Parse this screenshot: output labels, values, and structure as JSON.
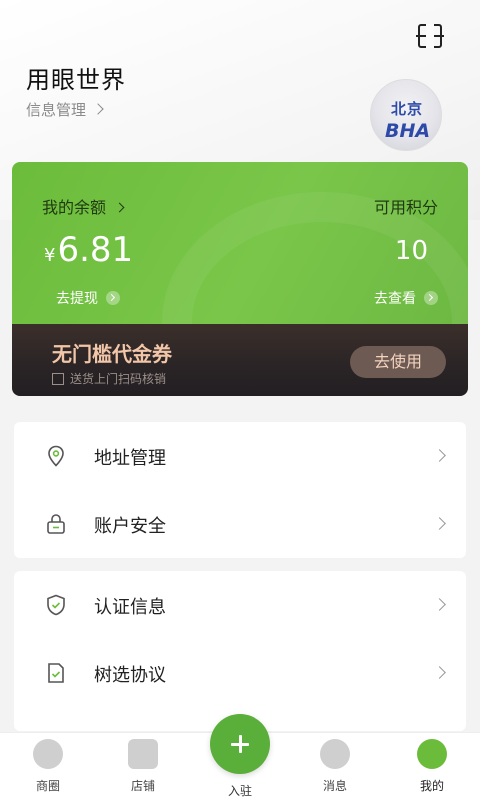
{
  "header": {
    "username": "用眼世界",
    "info_link": "信息管理",
    "avatar_text_line1": "北京",
    "avatar_text_line2": "BHA"
  },
  "wallet": {
    "balance_label": "我的余额",
    "currency_symbol": "¥",
    "balance_value": "6.81",
    "points_label": "可用积分",
    "points_value": "10",
    "withdraw_link": "去提现",
    "view_link": "去查看"
  },
  "coupon": {
    "title": "无门槛代金券",
    "subtitle": "送货上门扫码核销",
    "button": "去使用"
  },
  "menu_group_1": [
    {
      "label": "地址管理",
      "icon": "location-icon"
    },
    {
      "label": "账户安全",
      "icon": "lock-icon"
    }
  ],
  "menu_group_2": [
    {
      "label": "认证信息",
      "icon": "shield-check-icon"
    },
    {
      "label": "树选协议",
      "icon": "document-check-icon"
    }
  ],
  "tabbar": {
    "tabs": [
      {
        "label": "商圈",
        "icon": "compass-icon"
      },
      {
        "label": "店铺",
        "icon": "store-icon"
      },
      {
        "label": "入驻",
        "icon": "plus-icon"
      },
      {
        "label": "消息",
        "icon": "message-icon"
      },
      {
        "label": "我的",
        "icon": "profile-face-icon",
        "active": true
      }
    ]
  },
  "colors": {
    "accent_green": "#6cbc3b",
    "coupon_dark": "#2a2426",
    "coupon_text": "#f2c6a8"
  }
}
